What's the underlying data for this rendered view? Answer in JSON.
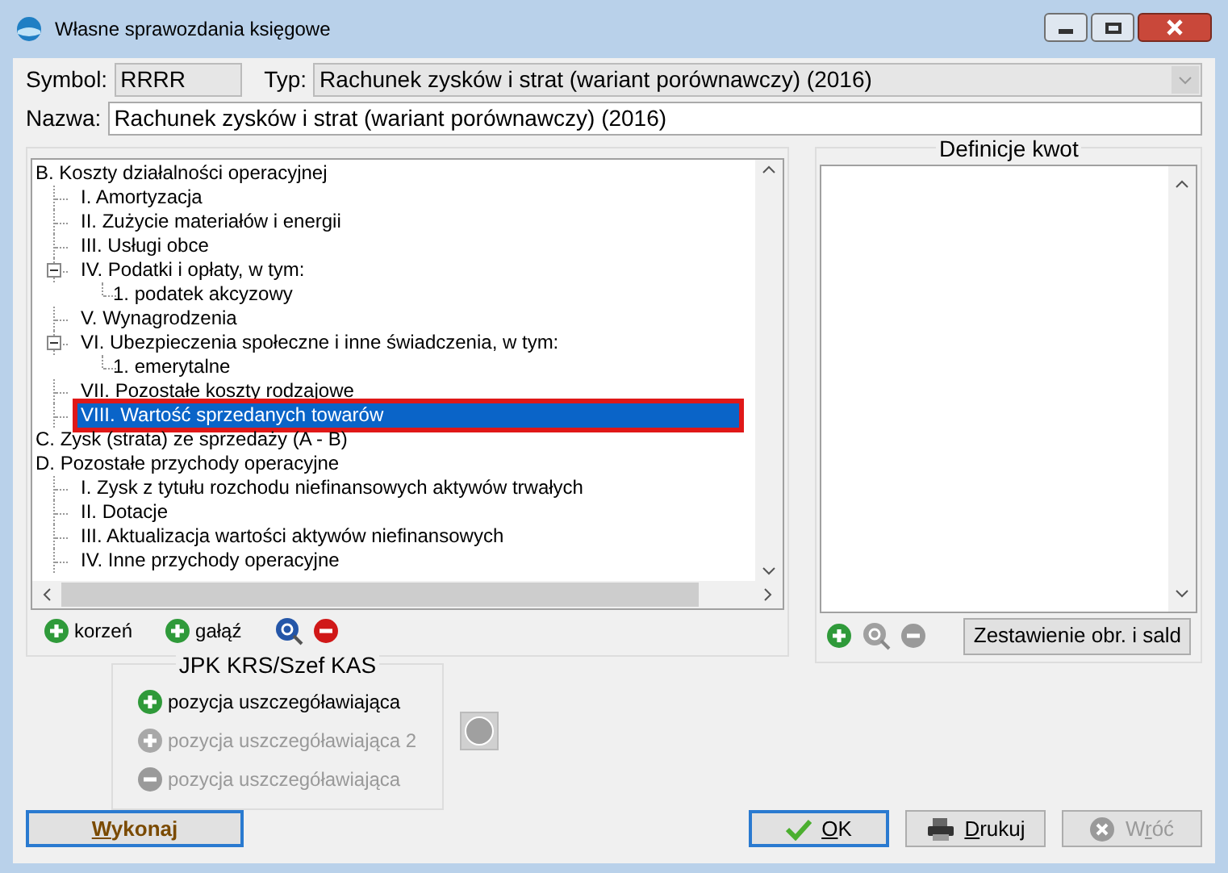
{
  "window": {
    "title": "Własne sprawozdania księgowe"
  },
  "header": {
    "symbol_label": "Symbol:",
    "symbol_value": "RRRR",
    "type_label": "Typ:",
    "type_value": "Rachunek zysków i strat (wariant porównawczy) (2016)",
    "name_label": "Nazwa:",
    "name_value": "Rachunek zysków i strat (wariant porównawczy) (2016)"
  },
  "tree": [
    {
      "label": "B. Koszty działalności operacyjnej",
      "selected": false,
      "children": [
        {
          "label": "I. Amortyzacja",
          "selected": false
        },
        {
          "label": "II. Zużycie materiałów i energii",
          "selected": false
        },
        {
          "label": "III. Usługi obce",
          "selected": false
        },
        {
          "label": "IV. Podatki i opłaty, w tym:",
          "selected": false,
          "expanded": true,
          "children": [
            {
              "label": "1. podatek akcyzowy",
              "selected": false
            }
          ]
        },
        {
          "label": "V. Wynagrodzenia",
          "selected": false
        },
        {
          "label": "VI. Ubezpieczenia społeczne i inne świadczenia, w tym:",
          "selected": false,
          "expanded": true,
          "children": [
            {
              "label": "1. emerytalne",
              "selected": false
            }
          ]
        },
        {
          "label": "VII. Pozostałe koszty rodzajowe",
          "selected": false
        },
        {
          "label": "VIII. Wartość sprzedanych towarów",
          "selected": true
        }
      ]
    },
    {
      "label": "C. Zysk (strata) ze sprzedaży (A - B)",
      "selected": false
    },
    {
      "label": "D. Pozostałe przychody operacyjne",
      "selected": false,
      "children": [
        {
          "label": "I. Zysk z tytułu rozchodu niefinansowych aktywów trwałych",
          "selected": false
        },
        {
          "label": "II. Dotacje",
          "selected": false
        },
        {
          "label": "III. Aktualizacja wartości aktywów niefinansowych",
          "selected": false
        },
        {
          "label": "IV. Inne przychody operacyjne",
          "selected": false
        }
      ]
    }
  ],
  "tree_tools": [
    {
      "kind": "add",
      "label": "korzeń",
      "disabled": false
    },
    {
      "kind": "add",
      "label": "gałąź",
      "disabled": false
    },
    {
      "kind": "zoom",
      "disabled": false
    },
    {
      "kind": "remove",
      "disabled": false
    }
  ],
  "amounts": {
    "title": "Definicje kwot",
    "tools": [
      {
        "kind": "add",
        "disabled": false
      },
      {
        "kind": "zoom",
        "disabled": true
      },
      {
        "kind": "remove",
        "disabled": true
      }
    ],
    "button": "Zestawienie obr. i sald"
  },
  "jpk": {
    "title": "JPK KRS/Szef KAS",
    "items": [
      {
        "kind": "add",
        "label": "pozycja uszczegóławiająca",
        "disabled": false
      },
      {
        "kind": "add",
        "label": "pozycja uszczegóławiająca 2",
        "disabled": true
      },
      {
        "kind": "remove",
        "label": "pozycja uszczegóławiająca",
        "disabled": true
      }
    ]
  },
  "buttons": [
    {
      "kind": "run",
      "key": "W",
      "post": "ykonaj",
      "disabled": false
    },
    {
      "kind": "ok",
      "key": "O",
      "post": "K",
      "disabled": false
    },
    {
      "kind": "print",
      "key": "D",
      "post": "rukuj",
      "disabled": false
    },
    {
      "kind": "back",
      "pre": "W",
      "key": "r",
      "post": "óć",
      "disabled": true
    }
  ]
}
